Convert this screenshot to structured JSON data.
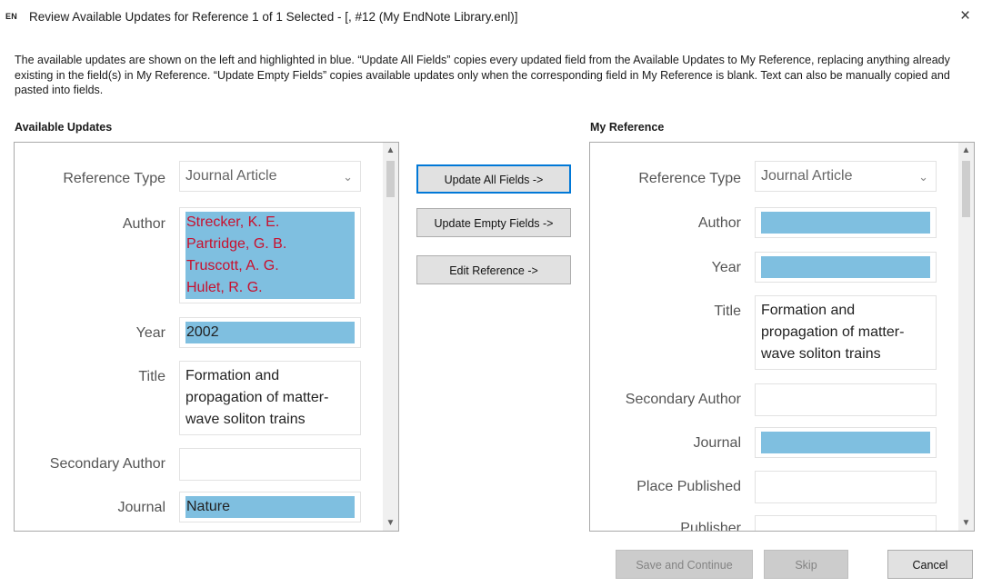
{
  "window": {
    "app_badge": "EN",
    "title": "Review Available Updates for Reference 1 of 1 Selected - [,  #12 (My EndNote Library.enl)]",
    "close_glyph": "×"
  },
  "intro_text": "The available updates are shown on the left and highlighted in blue. “Update All Fields” copies every updated field from the Available Updates to My Reference, replacing anything already existing in the field(s) in My Reference. “Update Empty Fields” copies available updates only when the corresponding field in My Reference is blank. Text can also be manually copied and pasted into fields.",
  "available_updates": {
    "heading": "Available Updates",
    "reference_type": {
      "label": "Reference Type",
      "value": "Journal Article"
    },
    "author": {
      "label": "Author",
      "lines": [
        "Strecker, K. E.",
        "Partridge, G. B.",
        "Truscott, A. G.",
        "Hulet, R. G."
      ]
    },
    "year": {
      "label": "Year",
      "value": "2002"
    },
    "title": {
      "label": "Title",
      "lines": [
        "Formation and",
        "propagation of matter-",
        "wave soliton trains"
      ]
    },
    "secondary_author": {
      "label": "Secondary Author",
      "value": ""
    },
    "journal": {
      "label": "Journal",
      "value": "Nature"
    }
  },
  "actions": {
    "update_all": "Update All Fields ->",
    "update_empty": "Update Empty Fields ->",
    "edit_reference": "Edit Reference ->"
  },
  "my_reference": {
    "heading": "My Reference",
    "reference_type": {
      "label": "Reference Type",
      "value": "Journal Article"
    },
    "author": {
      "label": "Author"
    },
    "year": {
      "label": "Year"
    },
    "title": {
      "label": "Title",
      "lines": [
        "Formation and",
        "propagation of matter-",
        "wave soliton trains"
      ]
    },
    "secondary_author": {
      "label": "Secondary Author",
      "value": ""
    },
    "journal": {
      "label": "Journal"
    },
    "place_published": {
      "label": "Place Published",
      "value": ""
    },
    "publisher": {
      "label": "Publisher"
    }
  },
  "footer": {
    "save_continue": "Save and Continue",
    "skip": "Skip",
    "cancel": "Cancel"
  },
  "icons": {
    "chevron": "⌄",
    "scroll_up": "▲",
    "scroll_down": "▼"
  },
  "colors": {
    "highlight": "#7fbfe0",
    "changed_text": "#c8102e",
    "primary_border": "#0078d7"
  }
}
